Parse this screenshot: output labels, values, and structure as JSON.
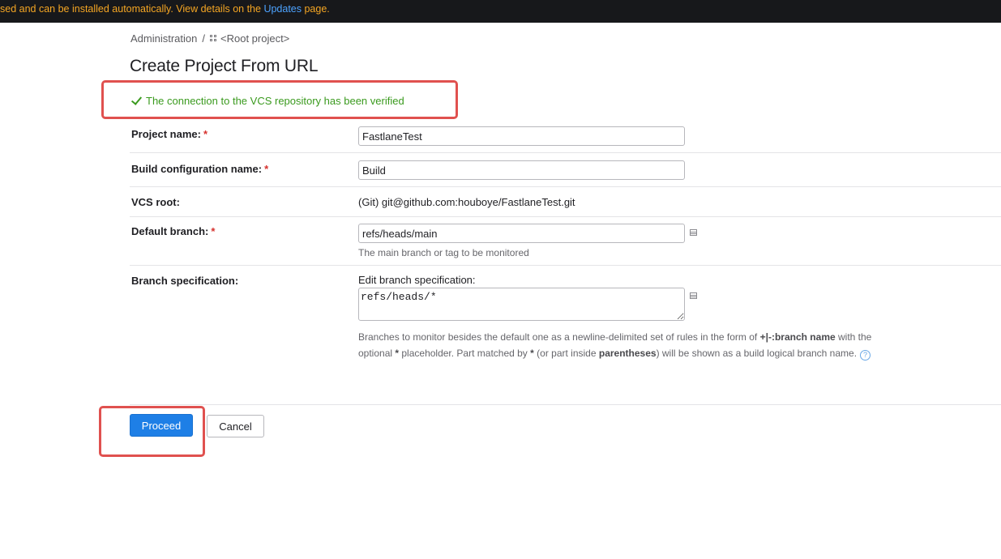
{
  "banner": {
    "text_before": "sed and can be installed automatically. View details on the ",
    "link_text": "Updates",
    "text_after": " page."
  },
  "breadcrumb": {
    "root": "Administration",
    "separator": "/",
    "project": "<Root project>",
    "project_icon": "project-grid-icon"
  },
  "page": {
    "title": "Create Project From URL"
  },
  "status": {
    "icon": "checkmark-icon",
    "message": "The connection to the VCS repository has been verified",
    "color": "#3a9a1e"
  },
  "form": {
    "required_mark": "*",
    "project_name": {
      "label": "Project name:",
      "value": "FastlaneTest"
    },
    "build_config_name": {
      "label": "Build configuration name:",
      "value": "Build"
    },
    "vcs_root": {
      "label": "VCS root:",
      "value": "(Git) git@github.com:houboye/FastlaneTest.git"
    },
    "default_branch": {
      "label": "Default branch:",
      "value": "refs/heads/main",
      "note": "The main branch or tag to be monitored",
      "icon": "list-icon"
    },
    "branch_spec": {
      "label": "Branch specification:",
      "sublabel": "Edit branch specification:",
      "value": "refs/heads/*",
      "icon": "list-icon",
      "help": {
        "t1": "Branches to monitor besides the default one as a newline-delimited set of rules in the form of ",
        "b1": "+|-:branch name",
        "t2": " with the optional ",
        "b2": "*",
        "t3": " placeholder. Part matched by ",
        "b3": "*",
        "t4": " (or part inside ",
        "b4": "parentheses",
        "t5": ") will be shown as a build logical branch name.",
        "icon_glyph": "?"
      }
    }
  },
  "actions": {
    "proceed_label": "Proceed",
    "cancel_label": "Cancel"
  },
  "colors": {
    "accent": "#1e7fe6",
    "annotation": "#e0514f",
    "banner_bg": "#17181b",
    "banner_text": "#f5a623",
    "required": "#d6322e"
  }
}
